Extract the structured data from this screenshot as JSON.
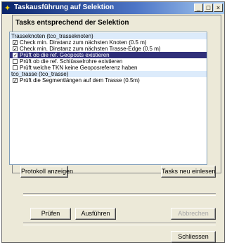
{
  "window": {
    "title": "Taskausführung auf Selektion"
  },
  "panel": {
    "title": "Tasks entsprechend der Selektion"
  },
  "list": {
    "groups": [
      {
        "label": "Trasseknoten (tco_trasseknoten)",
        "items": [
          {
            "label": "Check min. Dinstanz zum nächsten Knoten (0.5 m)",
            "checked": true,
            "selected": false
          },
          {
            "label": "Check min. Dinstanz zum nächsten Trasse-Edge (0.5 m)",
            "checked": true,
            "selected": false
          },
          {
            "label": "Prüft ob die ref. Geoposts existieren",
            "checked": true,
            "selected": true
          },
          {
            "label": "Prüft ob die ref. Schlüsselrohre existieren",
            "checked": false,
            "selected": false
          },
          {
            "label": "Prüft welche TKN keine Geoposreferenz haben",
            "checked": false,
            "selected": false
          }
        ]
      },
      {
        "label": "tco_trasse (tco_trasse)",
        "items": [
          {
            "label": "Prüft die Segmentlängen auf dem Trasse (0.5m)",
            "checked": true,
            "selected": false
          }
        ]
      }
    ]
  },
  "buttons": {
    "protokoll": "Protokoll anzeigen",
    "tasks_neu": "Tasks neu einlesen",
    "pruefen": "Prüfen",
    "ausfuehren": "Ausführen",
    "abbrechen": "Abbrechen",
    "schliessen": "Schliessen"
  },
  "controls": {
    "minimize": "_",
    "maximize": "□",
    "close": "×"
  }
}
